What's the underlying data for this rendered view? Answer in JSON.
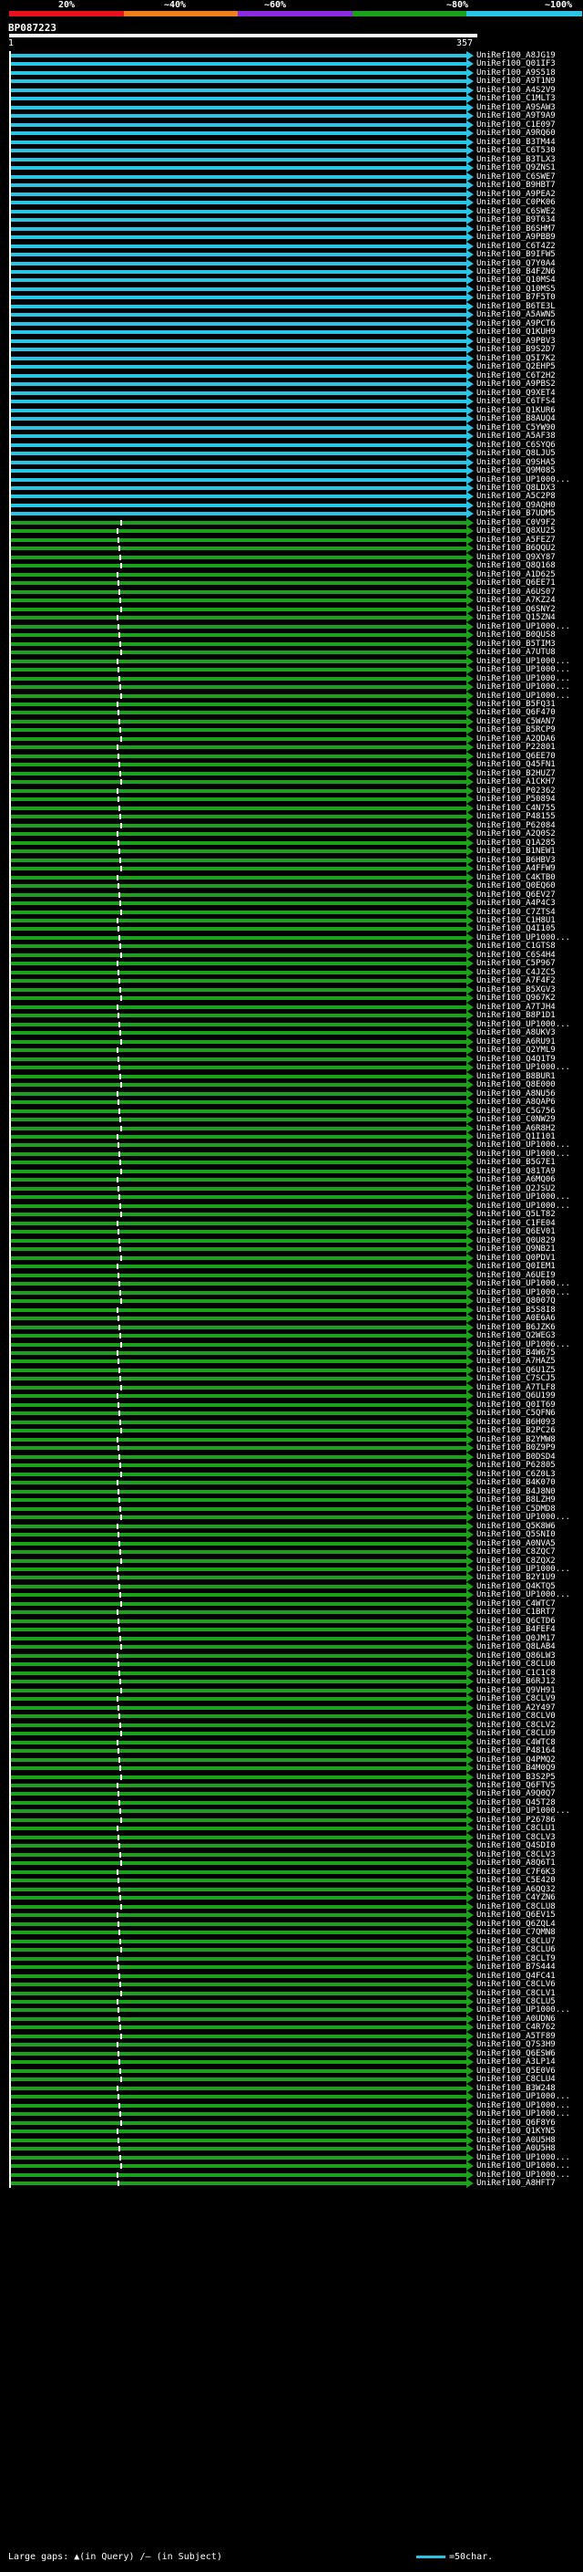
{
  "identity_scale": {
    "ticks": [
      "20%",
      "~40%",
      "~60%",
      "~80%",
      "~100%"
    ],
    "colors": [
      "#e8111c",
      "#f07f1b",
      "#8a2be2",
      "#1aa31a",
      "#29c5e6"
    ]
  },
  "query": {
    "id": "BP087223",
    "start_label": "1",
    "end_label": "357"
  },
  "hits": [
    "UniRef100_A8JG19",
    "UniRef100_Q01IF3",
    "UniRef100_A9S518",
    "UniRef100_A9T1N9",
    "UniRef100_A4S2V9",
    "UniRef100_C1MLT3",
    "UniRef100_A9SAW3",
    "UniRef100_A9T9A9",
    "UniRef100_C1E097",
    "UniRef100_A9RQ60",
    "UniRef100_B3TM44",
    "UniRef100_C6T530",
    "UniRef100_B3TLX3",
    "UniRef100_Q9ZNS1",
    "UniRef100_C6SWE7",
    "UniRef100_B9HBT7",
    "UniRef100_A9PEA2",
    "UniRef100_C0PK06",
    "UniRef100_C6SWE2",
    "UniRef100_B9T634",
    "UniRef100_B6SHM7",
    "UniRef100_A9PBB9",
    "UniRef100_C6T4Z2",
    "UniRef100_B9IFW5",
    "UniRef100_Q7Y0A4",
    "UniRef100_B4FZN6",
    "UniRef100_Q10MS4",
    "UniRef100_Q10MS5",
    "UniRef100_B7F5T0",
    "UniRef100_B6TE3L",
    "UniRef100_A5AWN5",
    "UniRef100_A9PCT6",
    "UniRef100_Q1KUH9",
    "UniRef100_A9PBV3",
    "UniRef100_B9S2D7",
    "UniRef100_Q5I7K2",
    "UniRef100_Q2EHP5",
    "UniRef100_C6T2H2",
    "UniRef100_A9PBS2",
    "UniRef100_Q9XET4",
    "UniRef100_C6TFS4",
    "UniRef100_Q1KUR6",
    "UniRef100_B8AUQ4",
    "UniRef100_C5YW90",
    "UniRef100_A5AF38",
    "UniRef100_C6SYQ6",
    "UniRef100_Q8LJU5",
    "UniRef100_Q9SHA5",
    "UniRef100_Q9M085",
    "UniRef100_UP1000...",
    "UniRef100_Q8LDX3",
    "UniRef100_A5C2P8",
    "UniRef100_Q9AQH0",
    "UniRef100_B7UDM5",
    "UniRef100_C0V9F2",
    "UniRef100_Q8XU25",
    "UniRef100_A5FEZ7",
    "UniRef100_B6QQU2",
    "UniRef100_Q9XY87",
    "UniRef100_Q8Q168",
    "UniRef100_A1D625",
    "UniRef100_Q6EE71",
    "UniRef100_A6US07",
    "UniRef100_A7KZ24",
    "UniRef100_Q6SNY2",
    "UniRef100_Q15ZN4",
    "UniRef100_UP1000...",
    "UniRef100_B0QUS8",
    "UniRef100_B5TIM3",
    "UniRef100_A7UTU8",
    "UniRef100_UP1000...",
    "UniRef100_UP1000...",
    "UniRef100_UP1000...",
    "UniRef100_UP1000...",
    "UniRef100_UP1000...",
    "UniRef100_B5FQ31",
    "UniRef100_Q6F470",
    "UniRef100_C5WAN7",
    "UniRef100_B5RCP9",
    "UniRef100_A2QDA6",
    "UniRef100_P22801",
    "UniRef100_Q6EE70",
    "UniRef100_Q45FN1",
    "UniRef100_B2HUZ7",
    "UniRef100_A1CKH7",
    "UniRef100_P02362",
    "UniRef100_P50894",
    "UniRef100_C4N755",
    "UniRef100_P48155",
    "UniRef100_P62084",
    "UniRef100_A2Q0S2",
    "UniRef100_Q1A285",
    "UniRef100_B1NEW1",
    "UniRef100_B6HBV3",
    "UniRef100_A4FFW9",
    "UniRef100_C4KTB0",
    "UniRef100_Q0EQ60",
    "UniRef100_Q6EV27",
    "UniRef100_A4P4C3",
    "UniRef100_C7ZTS4",
    "UniRef100_C1H8U1",
    "UniRef100_Q4I105",
    "UniRef100_UP1000...",
    "UniRef100_C1GTS8",
    "UniRef100_C6S4H4",
    "UniRef100_C5P967",
    "UniRef100_C4JZC5",
    "UniRef100_A7F4F2",
    "UniRef100_B5XGV3",
    "UniRef100_Q967K2",
    "UniRef100_A7TJH4",
    "UniRef100_B8P1D1",
    "UniRef100_UP1000...",
    "UniRef100_A8UKV3",
    "UniRef100_A6RU91",
    "UniRef100_Q2YML9",
    "UniRef100_Q4Q1T9",
    "UniRef100_UP1000...",
    "UniRef100_B8BUR1",
    "UniRef100_Q8E000",
    "UniRef100_A8NU56",
    "UniRef100_A8QAP6",
    "UniRef100_C5G756",
    "UniRef100_C0NW29",
    "UniRef100_A6R8H2",
    "UniRef100_Q1I101",
    "UniRef100_UP1000...",
    "UniRef100_UP1000...",
    "UniRef100_B5G7E1",
    "UniRef100_Q81TA9",
    "UniRef100_A6MQ06",
    "UniRef100_Q2JSU2",
    "UniRef100_UP1000...",
    "UniRef100_UP1000...",
    "UniRef100_Q5LT82",
    "UniRef100_C1FE04",
    "UniRef100_Q6EV01",
    "UniRef100_Q0U829",
    "UniRef100_Q9NB21",
    "UniRef100_Q0PDV1",
    "UniRef100_Q0IEM1",
    "UniRef100_A6UEI9",
    "UniRef100_UP1000...",
    "UniRef100_UP1000...",
    "UniRef100_Q8007Q",
    "UniRef100_B5S8I8",
    "UniRef100_A0E6A6",
    "UniRef100_B6JZK6",
    "UniRef100_Q2WEG3",
    "UniRef100_UP1006...",
    "UniRef100_B4W675",
    "UniRef100_A7HAZ5",
    "UniRef100_Q6U1Z5",
    "UniRef100_C7SCJ5",
    "UniRef100_A7TLF8",
    "UniRef100_Q6U199",
    "UniRef100_Q0IT69",
    "UniRef100_C5QFN6",
    "UniRef100_B6H093",
    "UniRef100_B2PC26",
    "UniRef100_B2YMW8",
    "UniRef100_B0Z9P9",
    "UniRef100_B0DSD4",
    "UniRef100_P62805",
    "UniRef100_C6Z0L3",
    "UniRef100_B4K070",
    "UniRef100_B4J8N0",
    "UniRef100_B8LZH9",
    "UniRef100_C5DMD8",
    "UniRef100_UP1000...",
    "UniRef100_Q5K8W6",
    "UniRef100_Q5SNI0",
    "UniRef100_A0NVA5",
    "UniRef100_C8ZQC7",
    "UniRef100_C8ZQX2",
    "UniRef100_UP1000...",
    "UniRef100_B2Y1U9",
    "UniRef100_Q4KTQ5",
    "UniRef100_UP1000...",
    "UniRef100_C4WTC7",
    "UniRef100_C1BRT7",
    "UniRef100_Q6CTD6",
    "UniRef100_B4FEF4",
    "UniRef100_Q0JM17",
    "UniRef100_Q8LAB4",
    "UniRef100_Q86LW3",
    "UniRef100_C8CLU0",
    "UniRef100_C1C1C8",
    "UniRef100_B6RJ12",
    "UniRef100_Q9VH91",
    "UniRef100_C8CLV9",
    "UniRef100_A2Y497",
    "UniRef100_C8CLV0",
    "UniRef100_C8CLV2",
    "UniRef100_C8CLU9",
    "UniRef100_C4WTC8",
    "UniRef100_P48164",
    "UniRef100_Q4PMQ2",
    "UniRef100_B4M0Q9",
    "UniRef100_B3S2P5",
    "UniRef100_Q6FTV5",
    "UniRef100_A9Q0Q7",
    "UniRef100_Q45T28",
    "UniRef100_UP1000...",
    "UniRef100_P26786",
    "UniRef100_C8CLU1",
    "UniRef100_C8CLV3",
    "UniRef100_Q4SDI0",
    "UniRef100_C8CLV3",
    "UniRef100_A8Q6T1",
    "UniRef100_C7F6K3",
    "UniRef100_C5E420",
    "UniRef100_A6QQ32",
    "UniRef100_C4YZN6",
    "UniRef100_C8CLU8",
    "UniRef100_Q6EV15",
    "UniRef100_Q6ZQL4",
    "UniRef100_C7QMN8",
    "UniRef100_C8CLU7",
    "UniRef100_C8CLU6",
    "UniRef100_C8CLT9",
    "UniRef100_B7S444",
    "UniRef100_Q4FC41",
    "UniRef100_C8CLV6",
    "UniRef100_C8CLV1",
    "UniRef100_C8CLU5",
    "UniRef100_UP1000...",
    "UniRef100_A0UDN6",
    "UniRef100_C4R762",
    "UniRef100_A5TF89",
    "UniRef100_Q7S3H9",
    "UniRef100_Q6ESW6",
    "UniRef100_A3LP14",
    "UniRef100_Q5E0V6",
    "UniRef100_C8CLU4",
    "UniRef100_B3W248",
    "UniRef100_UP1000...",
    "UniRef100_UP1000...",
    "UniRef100_UP1000...",
    "UniRef100_Q6F8Y6",
    "UniRef100_Q1KYN5",
    "UniRef100_A0U5H8",
    "UniRef100_A0U5H8",
    "UniRef100_UP1000...",
    "UniRef100_UP1000...",
    "UniRef100_UP1000...",
    "UniRef100_A8HFT7"
  ],
  "footer": {
    "large_gaps_label": "Large gaps:",
    "gap_query_label": "▲(in Query)",
    "gap_subject_label": "/– (in Subject)",
    "legend_text": "=50char."
  }
}
